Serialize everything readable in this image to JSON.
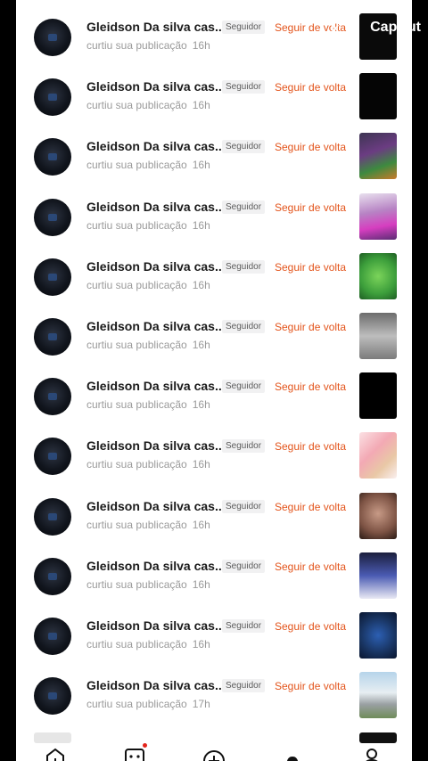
{
  "watermark": "CapCut",
  "notifications": [
    {
      "name": "Gleidson Da silva cas...",
      "badge": "Seguidor",
      "action": "Seguir de volta",
      "text": "curtiu sua publicação",
      "time": "16h",
      "thumb": "t0"
    },
    {
      "name": "Gleidson Da silva cas...",
      "badge": "Seguidor",
      "action": "Seguir de volta",
      "text": "curtiu sua publicação",
      "time": "16h",
      "thumb": "t1"
    },
    {
      "name": "Gleidson Da silva cas...",
      "badge": "Seguidor",
      "action": "Seguir de volta",
      "text": "curtiu sua publicação",
      "time": "16h",
      "thumb": "t2"
    },
    {
      "name": "Gleidson Da silva cas...",
      "badge": "Seguidor",
      "action": "Seguir de volta",
      "text": "curtiu sua publicação",
      "time": "16h",
      "thumb": "t3"
    },
    {
      "name": "Gleidson Da silva cas...",
      "badge": "Seguidor",
      "action": "Seguir de volta",
      "text": "curtiu sua publicação",
      "time": "16h",
      "thumb": "t4"
    },
    {
      "name": "Gleidson Da silva cas...",
      "badge": "Seguidor",
      "action": "Seguir de volta",
      "text": "curtiu sua publicação",
      "time": "16h",
      "thumb": "t5"
    },
    {
      "name": "Gleidson Da silva cas...",
      "badge": "Seguidor",
      "action": "Seguir de volta",
      "text": "curtiu sua publicação",
      "time": "16h",
      "thumb": "t6"
    },
    {
      "name": "Gleidson Da silva cas...",
      "badge": "Seguidor",
      "action": "Seguir de volta",
      "text": "curtiu sua publicação",
      "time": "16h",
      "thumb": "t7"
    },
    {
      "name": "Gleidson Da silva cas...",
      "badge": "Seguidor",
      "action": "Seguir de volta",
      "text": "curtiu sua publicação",
      "time": "16h",
      "thumb": "t8"
    },
    {
      "name": "Gleidson Da silva cas...",
      "badge": "Seguidor",
      "action": "Seguir de volta",
      "text": "curtiu sua publicação",
      "time": "16h",
      "thumb": "t9"
    },
    {
      "name": "Gleidson Da silva cas...",
      "badge": "Seguidor",
      "action": "Seguir de volta",
      "text": "curtiu sua publicação",
      "time": "16h",
      "thumb": "t10"
    },
    {
      "name": "Gleidson Da silva cas...",
      "badge": "Seguidor",
      "action": "Seguir de volta",
      "text": "curtiu sua publicação",
      "time": "17h",
      "thumb": "t11"
    }
  ],
  "bottom_nav": [
    {
      "icon": "home-icon"
    },
    {
      "icon": "friends-icon",
      "has_dot": true
    },
    {
      "icon": "create-plus-icon"
    },
    {
      "icon": "inbox-icon"
    },
    {
      "icon": "profile-icon"
    }
  ],
  "colors": {
    "accent": "#e3541b",
    "badge_bg": "#f1f1f2",
    "text": "#1a1a1a",
    "muted": "#9a9a9a"
  }
}
